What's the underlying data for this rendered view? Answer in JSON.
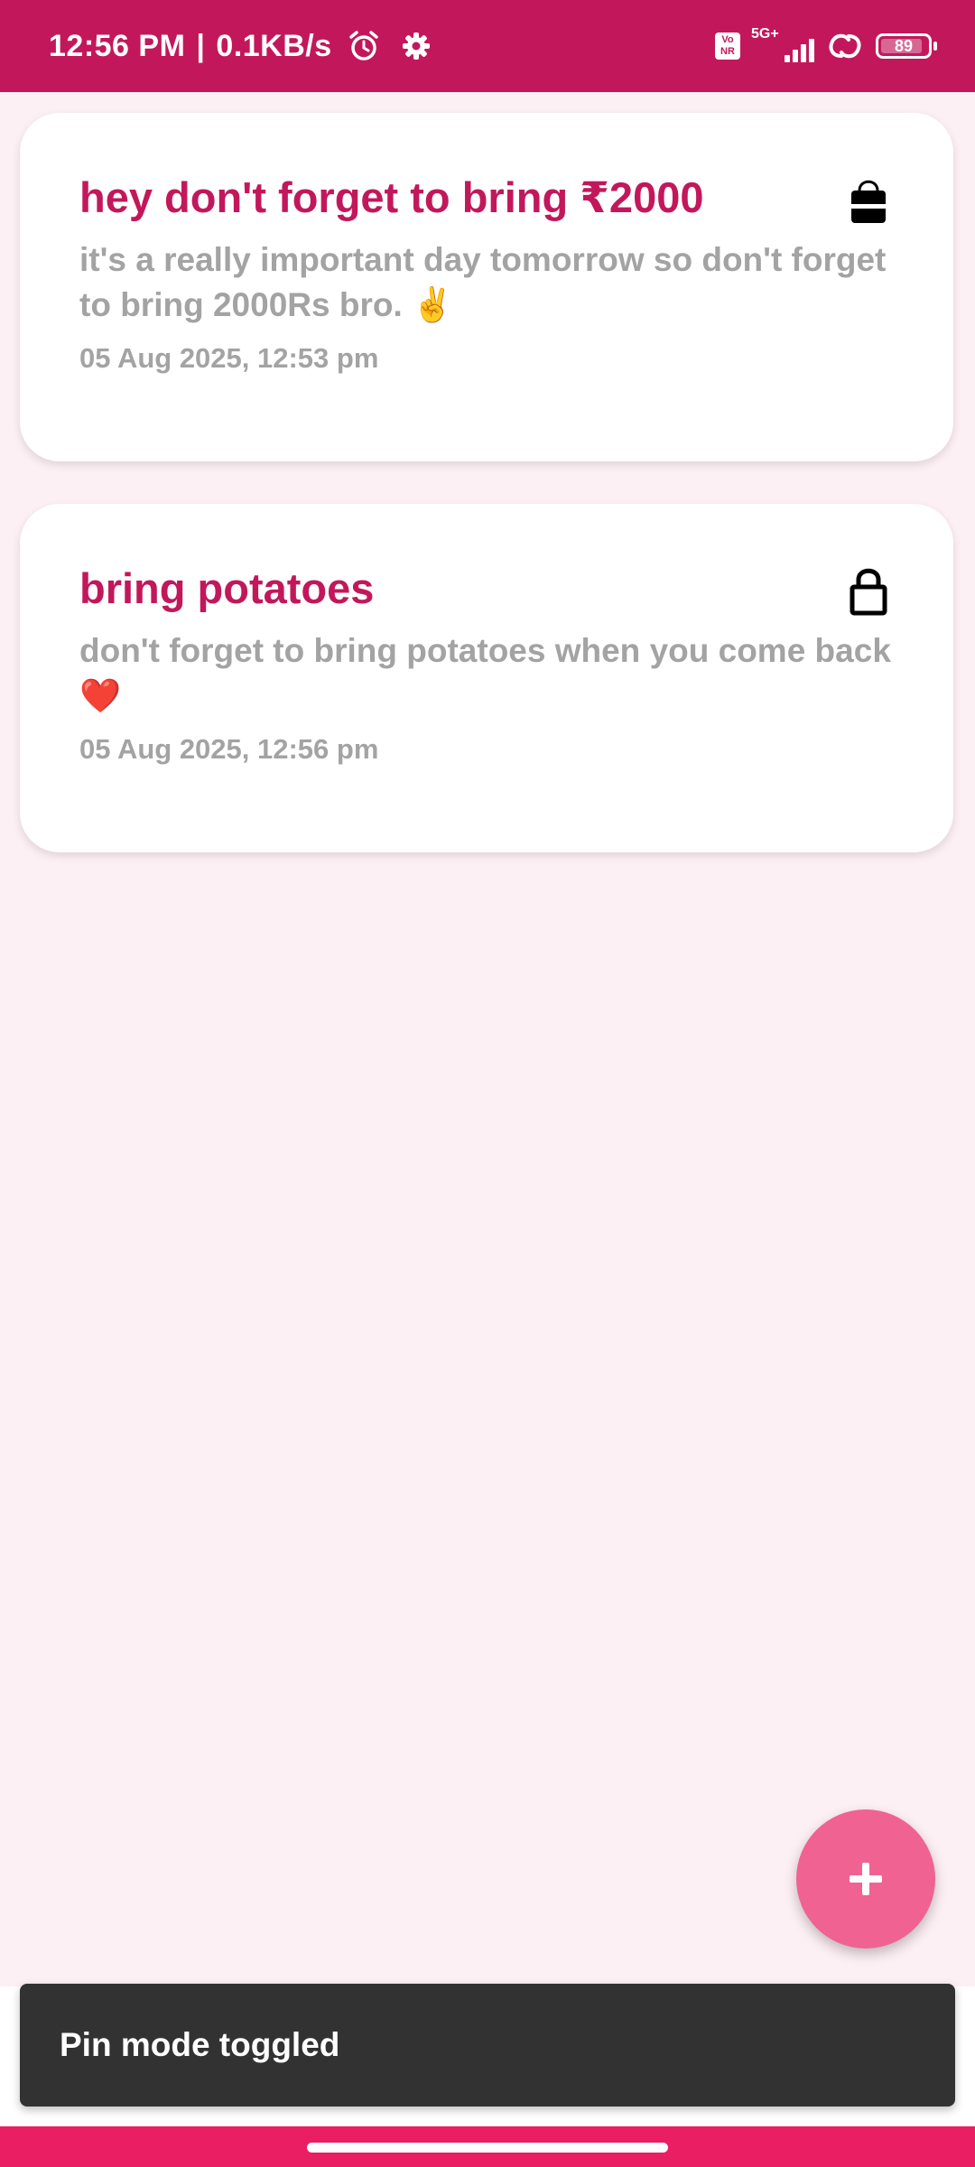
{
  "status_bar": {
    "time": "12:56 PM",
    "separator": "|",
    "speed": "0.1KB/s",
    "network_type": "5G+",
    "volte_top": "Vo",
    "volte_bottom": "NR",
    "battery_level": "89",
    "battery_fraction": 0.89
  },
  "notes": [
    {
      "title": "hey don't forget to bring ₹2000",
      "body": "it's a really important day tomorrow so don't forget to bring 2000Rs bro. ✌️",
      "date": "05 Aug 2025, 12:53 pm",
      "lock_state": "unlocked"
    },
    {
      "title": "bring potatoes",
      "body": "don't forget to bring potatoes when you come back ❤️",
      "date": "05 Aug 2025, 12:56 pm",
      "lock_state": "locked"
    }
  ],
  "fab": {
    "icon": "plus-icon"
  },
  "snackbar": {
    "message": "Pin mode toggled"
  },
  "colors": {
    "primary": "#c2185b",
    "accent": "#f06292",
    "background": "#fdf0f4",
    "nav_bar": "#e91e63"
  }
}
